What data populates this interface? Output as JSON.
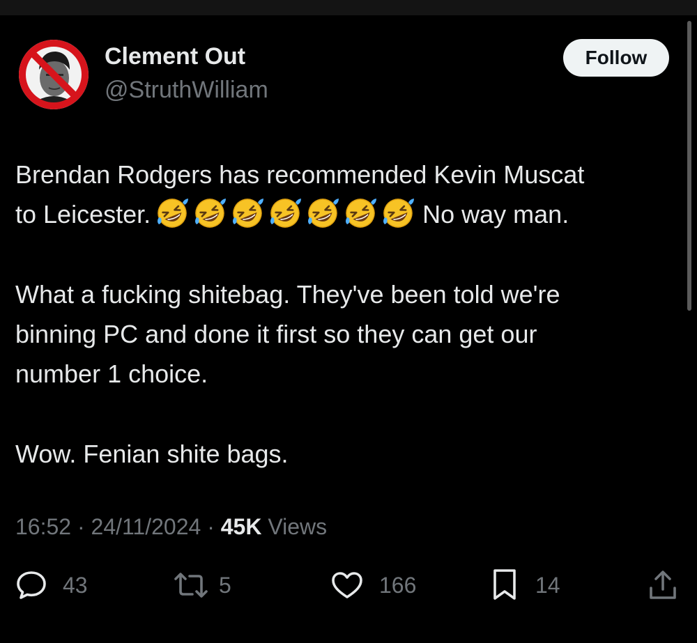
{
  "tweet": {
    "author": {
      "display_name": "Clement Out",
      "handle": "@StruthWilliam",
      "avatar_icon": "no-symbol-over-portrait"
    },
    "follow_label": "Follow",
    "body": {
      "line1_text": "Brendan Rodgers has recommended Kevin Muscat",
      "line2_prefix": "to Leicester.",
      "emoji_name": "rolling-on-the-floor-laughing",
      "emoji_count": 7,
      "line2_suffix": "No way man.",
      "paragraph2_lines": [
        "What a fucking shitebag. They've been told we're",
        "binning PC and done it first so they can get our",
        "number 1 choice."
      ],
      "paragraph3": "Wow. Fenian shite bags."
    },
    "meta": {
      "time": "16:52",
      "separator": " · ",
      "date": "24/11/2024",
      "views_count": "45K",
      "views_label": " Views"
    },
    "actions": {
      "replies": "43",
      "reposts": "5",
      "likes": "166",
      "bookmarks": "14"
    }
  },
  "colors": {
    "background": "#000000",
    "text_primary": "#e7e9ea",
    "text_secondary": "#71767b",
    "follow_bg": "#eff3f4",
    "no_symbol_red": "#d6141c"
  }
}
